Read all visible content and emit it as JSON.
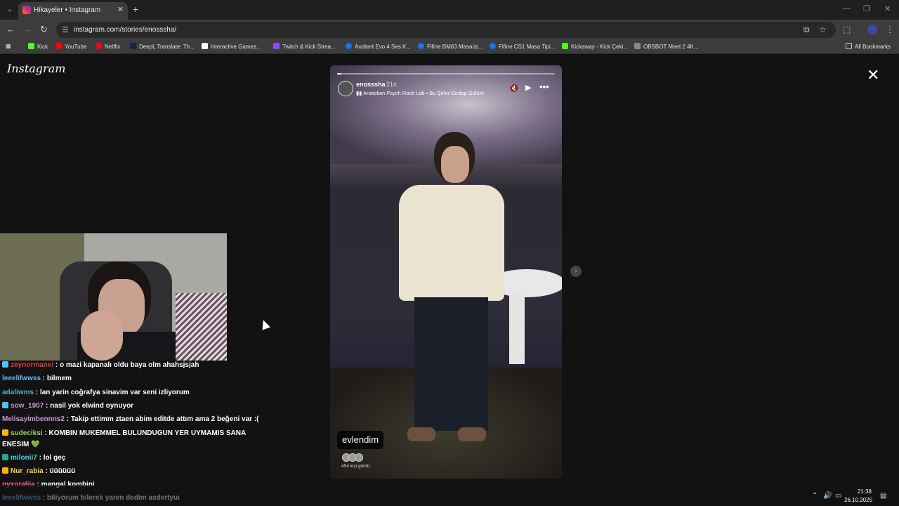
{
  "browser": {
    "tab_title": "Hikayeler • Instagram",
    "url": "instagram.com/stories/enosssha/",
    "bookmarks": [
      {
        "label": "Kick",
        "color": "#53fc18"
      },
      {
        "label": "YouTube",
        "color": "#ff0000"
      },
      {
        "label": "Netflix",
        "color": "#e50914"
      },
      {
        "label": "DeepL Translate: Th...",
        "color": "#0f2b46"
      },
      {
        "label": "Interactive Games...",
        "color": "#ffffff"
      },
      {
        "label": "Twitch & Kick Strea...",
        "color": "#9146ff"
      },
      {
        "label": "Audient Evo 4 Ses K...",
        "color": "#1a73e8"
      },
      {
        "label": "Fifine BM63 Masaüs...",
        "color": "#1a73e8"
      },
      {
        "label": "Fifine CS1 Masa Tipi...",
        "color": "#1a73e8"
      },
      {
        "label": "Kickaway - Kick Çeki...",
        "color": "#53fc18"
      },
      {
        "label": "OBSBOT Meet 2 4K...",
        "color": "#888888"
      }
    ],
    "all_bookmarks": "All Bookmarks"
  },
  "instagram": {
    "logo": "Instagram",
    "story": {
      "username": "enosssha",
      "time_ago": "21s",
      "music": "Anatolian Psych Rock Lab • Bu Şehir Girdap Gülüm",
      "caption": "evlendim",
      "viewers": "454 kişi gördü",
      "progress": 0.02
    }
  },
  "stream": {
    "chat": [
      {
        "user": "zeynormanei",
        "msg": "o mazi kapanalı oldu baya olm ahahsjsjah",
        "color": "#e53935",
        "badge": "#4fc3f7"
      },
      {
        "user": "leeelifwwss",
        "msg": "bilmem",
        "color": "#64b5f6",
        "badge": ""
      },
      {
        "user": "adaliwms",
        "msg": "lan yarin coğrafya sinavim var seni izliyorum",
        "color": "#4db6ac",
        "badge": ""
      },
      {
        "user": "sow_1907",
        "msg": "nasil yok elwind oynuyor",
        "color": "#ce93d8",
        "badge": "#4fc3f7"
      },
      {
        "user": "Melisayimbennns2",
        "msg": "Takip ettimm ztaen abim editde attım ama 2 beğeni var :(",
        "color": "#ce93d8",
        "badge": ""
      },
      {
        "user": "sudeciksi",
        "msg": "KOMBIN MUKEMMEL BULUNDUGUN YER UYMAMIS SANA",
        "color": "#9ccc65",
        "badge": "#ffb300"
      },
      {
        "user": "",
        "msg": "ENESIM 💚",
        "color": "#ffffff",
        "badge": ""
      },
      {
        "user": "milonii7",
        "msg": "lol geç",
        "color": "#4dd0e1",
        "badge": "#26a69a"
      },
      {
        "user": "Nur_rabia",
        "msg": "üüüüüü",
        "color": "#ffd54f",
        "badge": "#ffb300"
      },
      {
        "user": "nyxoraliia",
        "msg": "mangal kombini",
        "color": "#f06292",
        "badge": ""
      },
      {
        "user": "leeelifwwss",
        "msg": "biliyorum bilerek yaren dedim asdertyuı",
        "color": "#64b5f6",
        "badge": ""
      }
    ]
  },
  "taskbar": {
    "time": "21:38",
    "date": "26.10.2025"
  }
}
